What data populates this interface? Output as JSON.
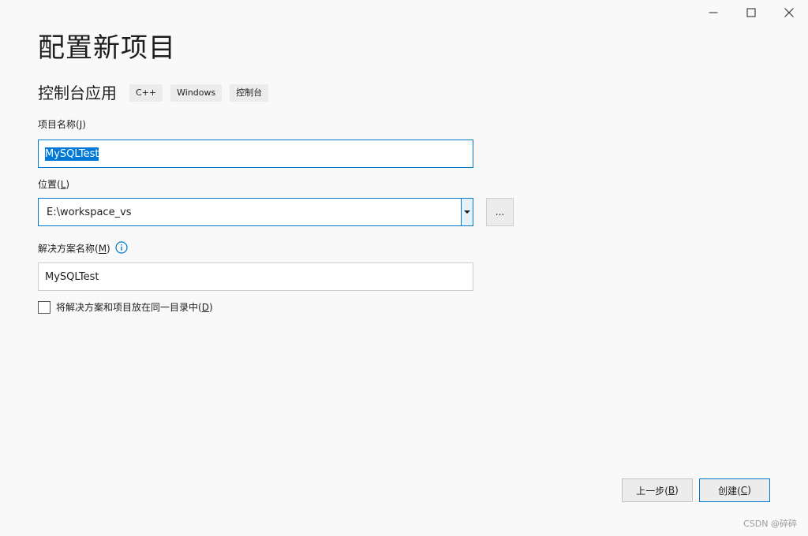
{
  "window": {
    "title": "配置新项目"
  },
  "template": {
    "name": "控制台应用",
    "tags": [
      "C++",
      "Windows",
      "控制台"
    ]
  },
  "project_name": {
    "label": "项目名称(",
    "mnemonic": "J",
    "label_end": ")",
    "value": "MySQLTest"
  },
  "location": {
    "label": "位置(",
    "mnemonic": "L",
    "label_end": ")",
    "value": "E:\\workspace_vs",
    "browse_label": "..."
  },
  "solution_name": {
    "label": "解决方案名称(",
    "mnemonic": "M",
    "label_end": ")",
    "value": "MySQLTest"
  },
  "same_dir": {
    "label": "将解决方案和项目放在同一目录中(",
    "mnemonic": "D",
    "label_end": ")",
    "checked": false
  },
  "buttons": {
    "back_label": "上一步(",
    "back_mnemonic": "B",
    "back_end": ")",
    "create_label": "创建(",
    "create_mnemonic": "C",
    "create_end": ")"
  },
  "watermark": "CSDN @碎碎",
  "colors": {
    "accent": "#007acc",
    "selection": "#0078d7",
    "background": "#f9f9f9"
  }
}
